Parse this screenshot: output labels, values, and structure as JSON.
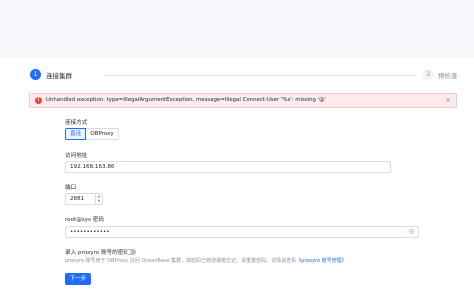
{
  "steps": [
    {
      "number": "1",
      "label": "连接集群"
    },
    {
      "number": "2",
      "label": "预检查"
    }
  ],
  "alert": {
    "text": "Unhandled exception. type=IllegalArgumentException, message=Illegal Connect-User '%s': missing '@'",
    "close": "×"
  },
  "form": {
    "conn_method_label": "连接方式",
    "conn_options": [
      "直连",
      "OBProxy"
    ],
    "address_label": "访问地址",
    "address_value": "192.168.163.86",
    "port_label": "端口",
    "port_value": "2881",
    "password_label": "root@sys 密码",
    "password_value": "••••••••••••",
    "proxyro_label": "录入 proxyro 账号的密码",
    "proxyro_hint": "proxyro 账号用于 OBProxy 访问 OceanBase 集群，如密码已修改或者忘记，请重置密码，详情请查看",
    "proxyro_link": "《proxyro 账号管理》",
    "next_button": "下一步"
  },
  "colors": {
    "accent": "#1f6dff",
    "error": "#f04438"
  }
}
